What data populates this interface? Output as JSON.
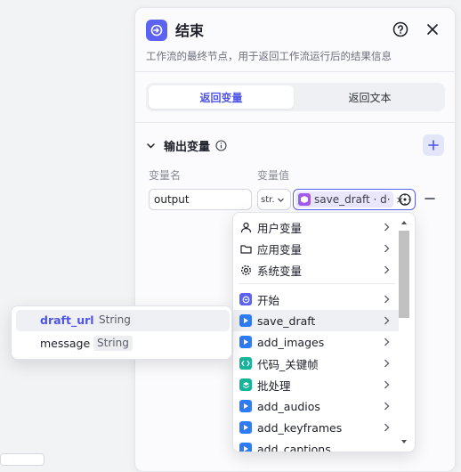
{
  "panel": {
    "title": "结束",
    "description": "工作流的最终节点，用于返回工作流运行后的结果信息",
    "tabs": [
      {
        "label": "返回变量",
        "active": true
      },
      {
        "label": "返回文本",
        "active": false
      }
    ],
    "section_title": "输出变量",
    "col_name_label": "变量名",
    "col_value_label": "变量值",
    "output": {
      "name": "output",
      "type": "str.",
      "ref_label": "save_draft · d·"
    }
  },
  "dropdown": {
    "items": [
      {
        "label": "用户变量",
        "icon": "person-icon"
      },
      {
        "label": "应用变量",
        "icon": "folder-icon"
      },
      {
        "label": "系统变量",
        "icon": "gear-icon"
      },
      {
        "label": "开始",
        "icon": "start-node-icon",
        "color": "#5c63f2"
      },
      {
        "label": "save_draft",
        "icon": "play-node-icon",
        "color": "#2f7bf5"
      },
      {
        "label": "add_images",
        "icon": "play-node-icon",
        "color": "#2f7bf5"
      },
      {
        "label": "代码_关键帧",
        "icon": "code-node-icon",
        "color": "#17b39b"
      },
      {
        "label": "批处理",
        "icon": "batch-node-icon",
        "color": "#17b39b"
      },
      {
        "label": "add_audios",
        "icon": "play-node-icon",
        "color": "#2f7bf5"
      },
      {
        "label": "add_keyframes",
        "icon": "play-node-icon",
        "color": "#2f7bf5"
      },
      {
        "label": "add_captions",
        "icon": "play-node-icon",
        "color": "#2f7bf5"
      }
    ]
  },
  "popover": {
    "fields": [
      {
        "name": "draft_url",
        "type": "String"
      },
      {
        "name": "message",
        "type": "String"
      }
    ]
  },
  "colors": {
    "accent": "#5c63f2",
    "node_blue": "#2f7bf5",
    "node_teal": "#17b39b",
    "node_purple": "#a05ce8"
  }
}
